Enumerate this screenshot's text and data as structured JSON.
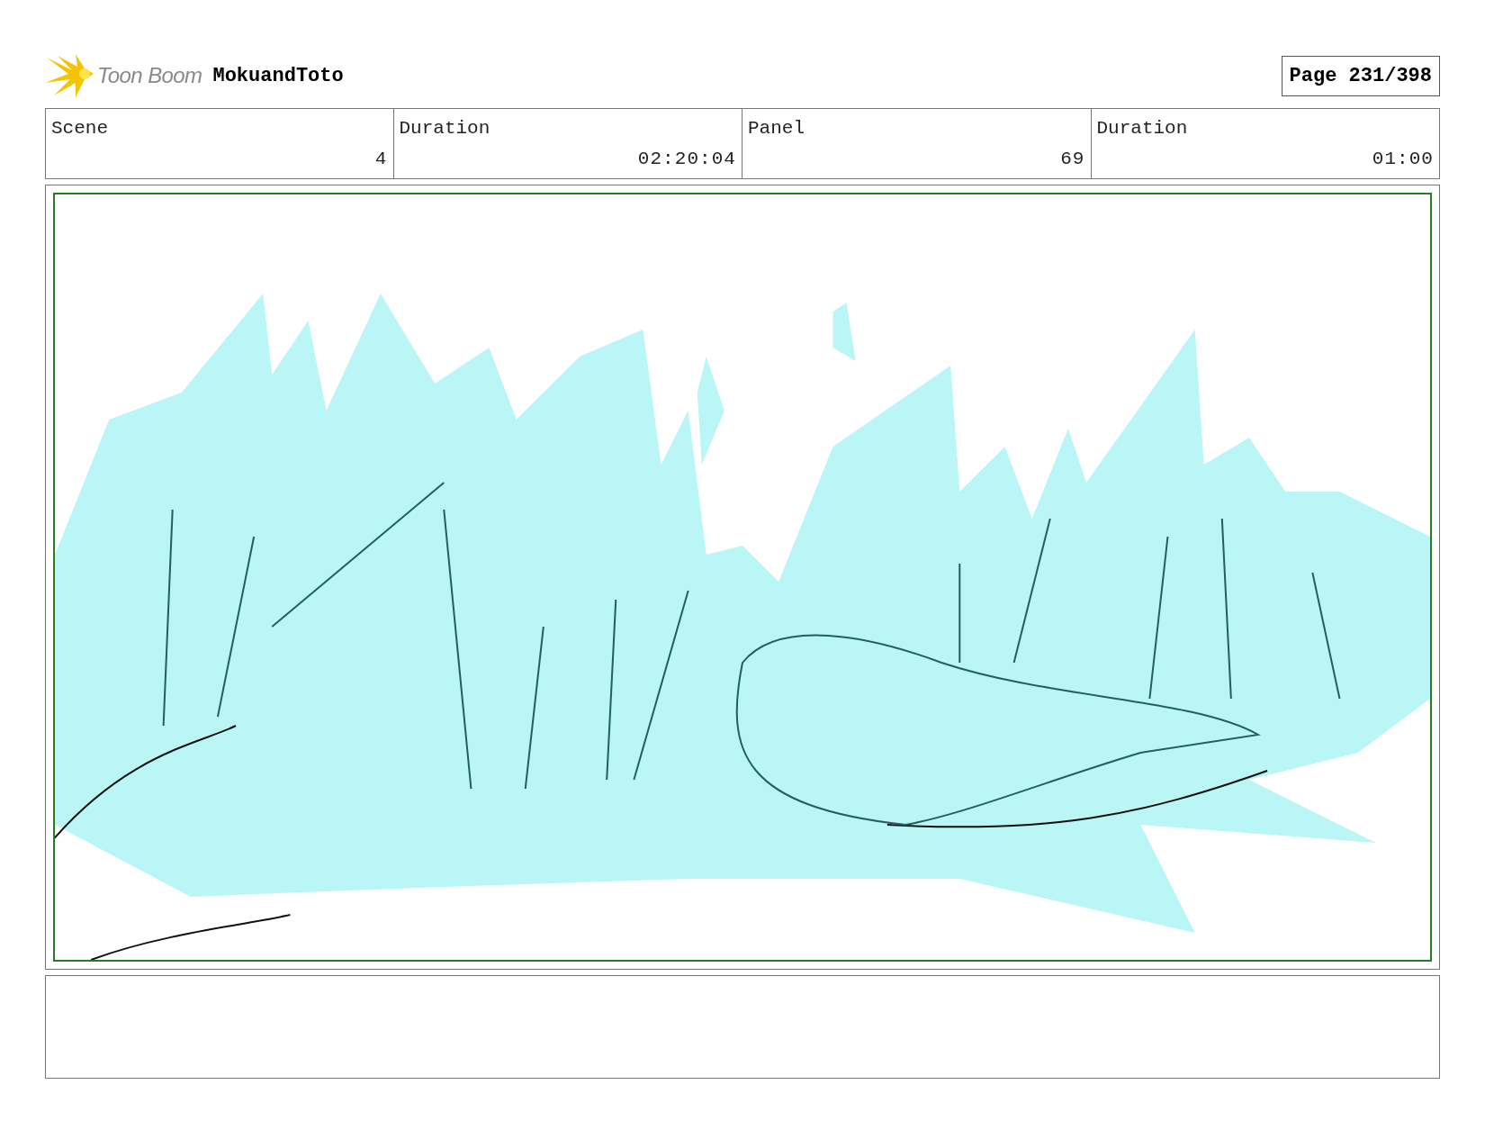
{
  "header": {
    "logo_text": "Toon Boom",
    "project": "MokuandToto",
    "page": "Page 231/398"
  },
  "info_table": {
    "columns": [
      "Scene",
      "Duration",
      "Panel",
      "Duration"
    ],
    "rows": [
      [
        "4",
        "02:20:04",
        "69",
        "01:00"
      ]
    ]
  }
}
